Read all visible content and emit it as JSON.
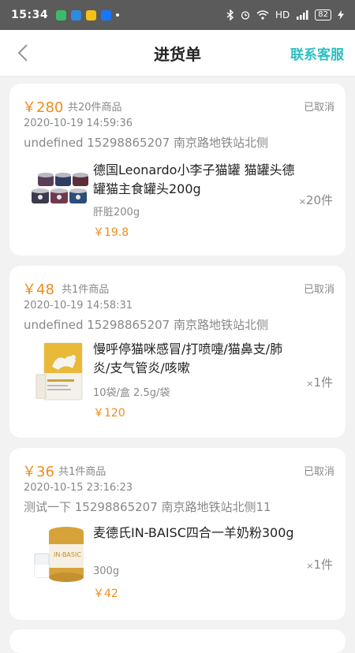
{
  "status_bar": {
    "time": "15:34",
    "net": "HD",
    "battery": "82"
  },
  "nav": {
    "back_icon": "chevron-left-icon",
    "title": "进货单",
    "service_label": "联系客服"
  },
  "colors": {
    "accent_teal": "#2bbfc2",
    "price_orange": "#f08c1b",
    "muted": "#888888"
  },
  "orders": [
    {
      "amount": "￥280",
      "count": "共20件商品",
      "status": "已取消",
      "time": "2020-10-19 14:59:36",
      "address": "undefined 15298865207 南京路地铁站北侧",
      "product_name": "德国Leonardo小李子猫罐 猫罐头德罐猫主食罐头200g",
      "spec": "肝脏200g",
      "price": "￥19.8",
      "qty_x": "×",
      "qty": "20件"
    },
    {
      "amount": "￥48",
      "count": "共1件商品",
      "status": "已取消",
      "time": "2020-10-19 14:58:31",
      "address": "undefined 15298865207 南京路地铁站北侧",
      "product_name": "慢呼停猫咪感冒/打喷嚏/猫鼻支/肺炎/支气管炎/咳嗽",
      "spec": "10袋/盒 2.5g/袋",
      "price": "￥120",
      "qty_x": "×",
      "qty": "1件"
    },
    {
      "amount": "￥36",
      "count": "共1件商品",
      "status": "已取消",
      "time": "2020-10-15 23:16:23",
      "address": "测试一下 15298865207 南京路地铁站北侧11",
      "product_name": "麦德氏IN-BAISC四合一羊奶粉300g",
      "spec": "300g",
      "price": "￥42",
      "qty_x": "×",
      "qty": "1件"
    }
  ]
}
